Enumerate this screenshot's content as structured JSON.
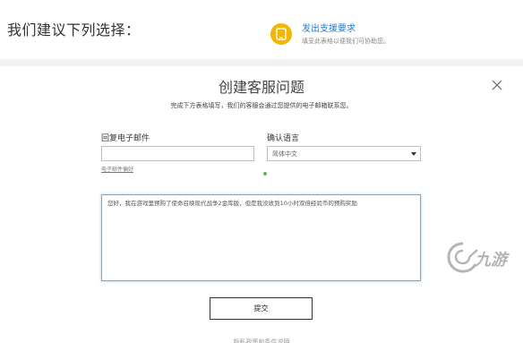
{
  "top": {
    "heading": "我们建议下列选择：",
    "support": {
      "icon": "phone-tablet-icon",
      "link_label": "发出支援要求",
      "description": "填妥此表格以便我们可协助您。"
    }
  },
  "modal": {
    "title": "创建客服问题",
    "subtitle": "完成下方表格填写，我们的客服会通过您提供的电子邮箱联系您。",
    "email": {
      "label": "回复电子邮件",
      "value": "",
      "policy_link": "电子邮件偏好"
    },
    "language": {
      "label": "确认语言",
      "selected": "简体中文"
    },
    "message": {
      "value": "您好，我在游戏里预购了使命召唤现代战争2金库版，但是我没收到10小时双倍经验币的预购奖励"
    },
    "submit_label": "提交",
    "footer_cut_text": "隐私政策和条件说明"
  },
  "watermark": {
    "text": "九游"
  },
  "colors": {
    "link": "#2a78c8",
    "support_icon_bg": "#f2b705",
    "focus_border": "#66afe9",
    "status_dot": "#5cb85c"
  }
}
